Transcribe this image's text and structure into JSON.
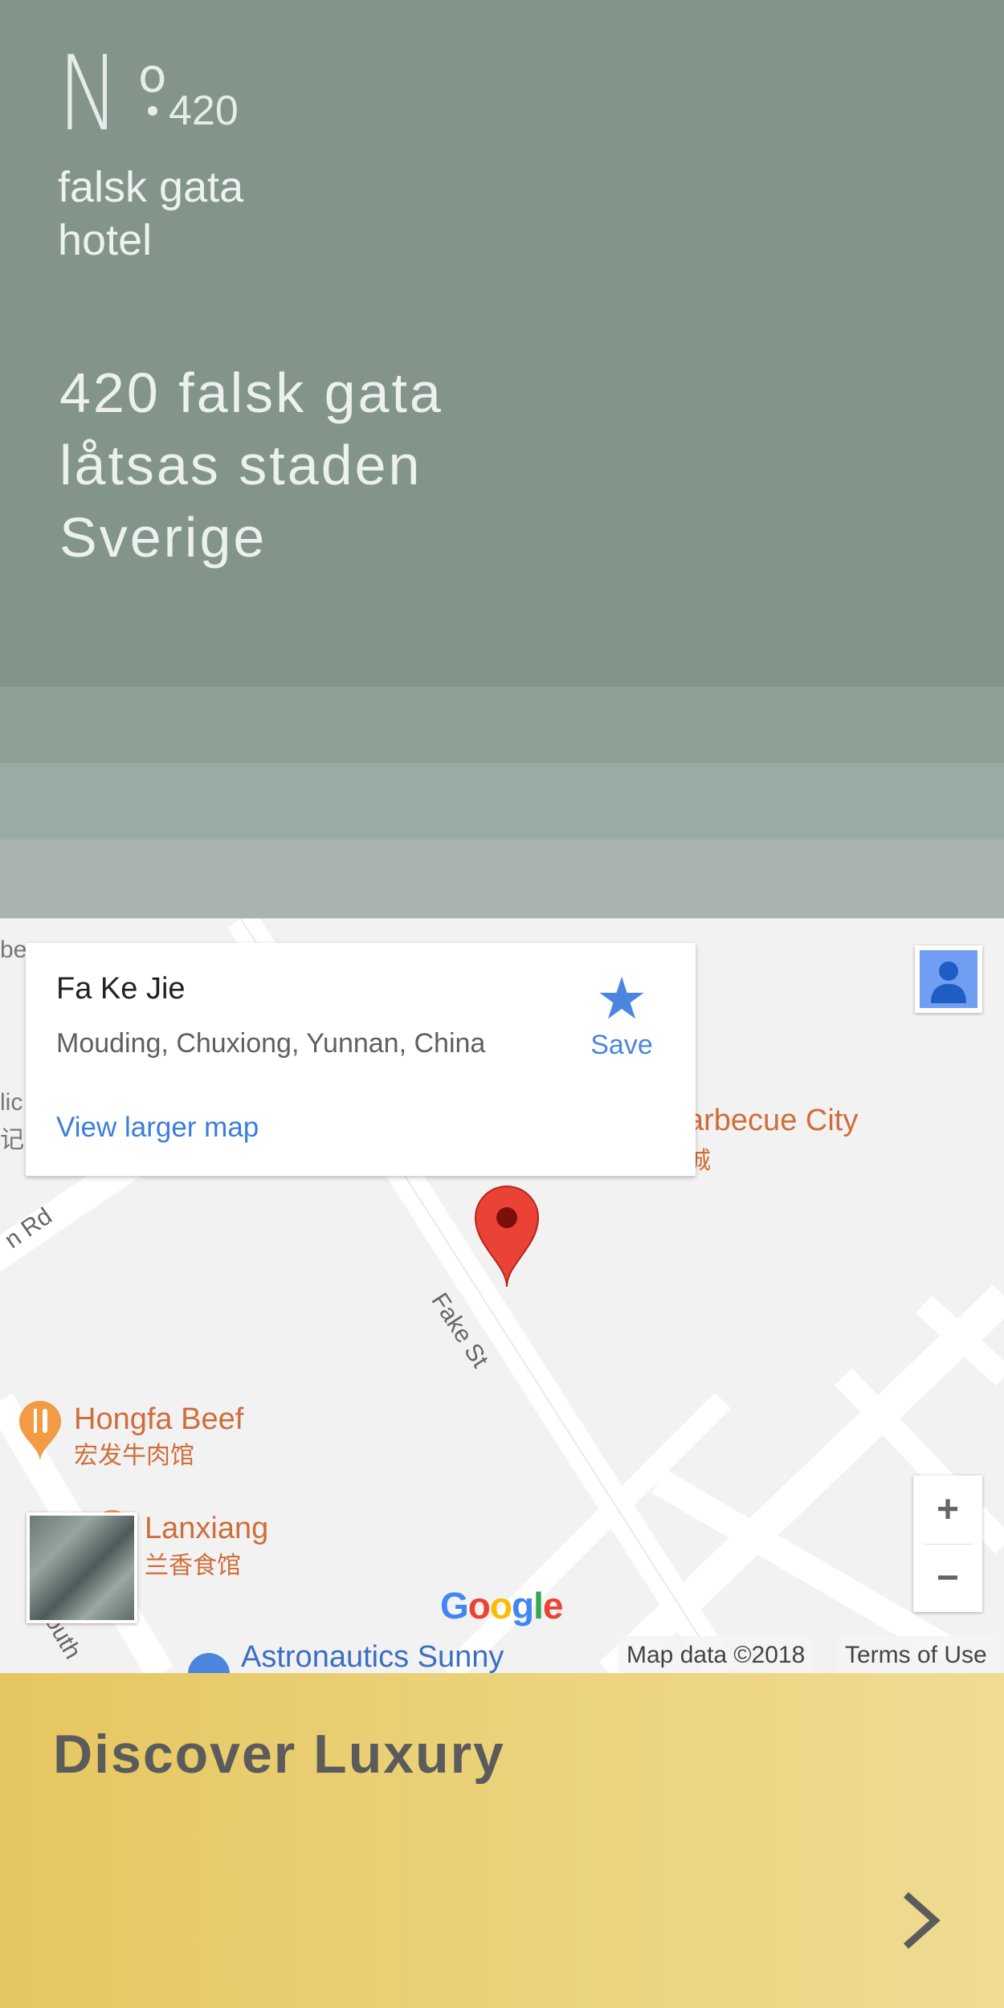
{
  "header": {
    "logo": {
      "letter": "N",
      "superscript": "o",
      "number": "420"
    },
    "brand_lines": [
      "falsk gata",
      "hotel"
    ],
    "address_lines": [
      "420 falsk gata",
      "låtsas staden",
      "Sverige"
    ]
  },
  "map": {
    "place_card": {
      "title": "Fa Ke Jie",
      "subtitle": "Mouding, Chuxiong, Yunnan, China",
      "save_label": "Save",
      "view_larger_label": "View larger map"
    },
    "pois": [
      {
        "name": "Hongfa Beef",
        "name_local": "宏发牛肉馆"
      },
      {
        "name": "Lanxiang",
        "name_local": "兰香食馆"
      },
      {
        "name": "arbecue City",
        "name_local": "城"
      },
      {
        "name": "Astronautics Sunny"
      }
    ],
    "roads": [
      "Fake St",
      "n Rd",
      "outh"
    ],
    "edge_text": [
      "be",
      "lic",
      "记"
    ],
    "zoom_in_label": "+",
    "zoom_out_label": "−",
    "google_logo": "Google",
    "map_data_label": "Map data ©2018",
    "terms_label": "Terms of Use",
    "icons": [
      "star-icon",
      "pegman-icon",
      "map-pin-icon",
      "restaurant-icon",
      "satellite-thumbnail"
    ]
  },
  "luxury": {
    "title": "Discover Luxury",
    "icon": "chevron-right-icon"
  },
  "colors": {
    "header_bg": "#83958a",
    "accent_blue": "#4b86de",
    "pin_red": "#ea4335",
    "gold": "#e6c660"
  }
}
